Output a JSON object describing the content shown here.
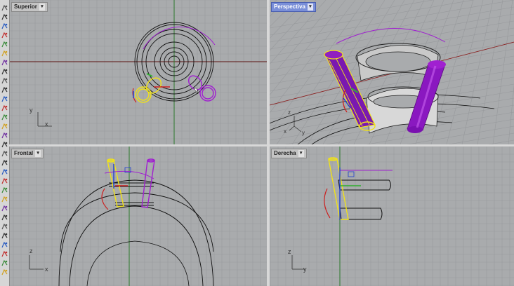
{
  "viewports": {
    "top": {
      "title": "Superior",
      "axis_a": "y",
      "axis_b": "x"
    },
    "perspective": {
      "title": "Perspectiva",
      "axis_a": "z",
      "axis_b": "y",
      "axis_c": "x"
    },
    "front": {
      "title": "Frontal",
      "axis_a": "z",
      "axis_b": "x"
    },
    "right": {
      "title": "Derecha",
      "axis_a": "z",
      "axis_b": "y"
    }
  },
  "toolbar": {
    "icons": [
      "point-icon",
      "curve-icon",
      "polyline-icon",
      "rectangle-icon",
      "circle-icon",
      "arc-icon",
      "ellipse-icon",
      "freeform-icon",
      "fillet-icon",
      "offset-icon",
      "surface-icon",
      "loft-icon",
      "sweep-icon",
      "extrude-icon",
      "solid-icon",
      "boolean-icon",
      "mesh-icon",
      "transform-icon",
      "move-icon",
      "rotate-icon",
      "scale-icon",
      "array-icon",
      "mirror-icon",
      "split-icon",
      "trim-icon",
      "join-icon",
      "explode-icon",
      "dimension-icon",
      "text-icon",
      "render-icon"
    ]
  },
  "colors": {
    "viewport_bg": "#a9abad",
    "active_tab": "#7a8fd8",
    "selected_yellow": "#f0e21a",
    "selected_purple": "#a020d0",
    "grid_red": "#b03030",
    "grid_green": "#30a030"
  }
}
